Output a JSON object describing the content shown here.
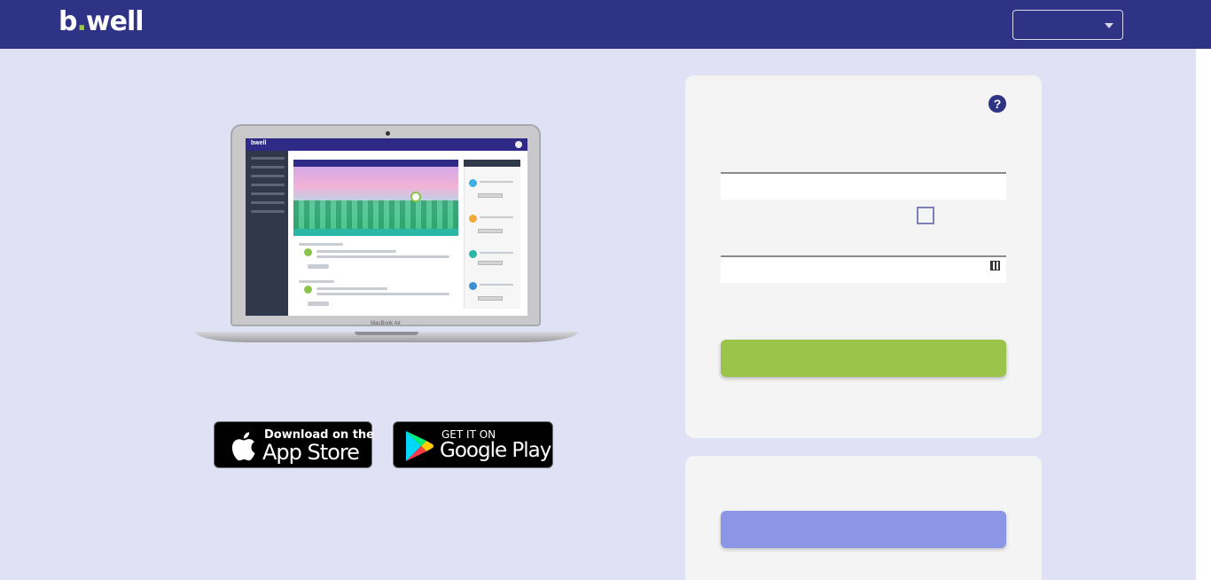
{
  "header": {
    "logo_text_b": "b",
    "logo_text_dot": ".",
    "logo_text_rest": "well",
    "language_select_value": "",
    "background_color": "#2e3386"
  },
  "hero": {
    "laptop_model_label": "MacBook Air",
    "app_preview_logo": "bwell"
  },
  "store_badges": {
    "app_store": {
      "small": "Download on the",
      "big": "App Store"
    },
    "google_play": {
      "small": "GET IT ON",
      "big": "Google Play"
    }
  },
  "login": {
    "help_icon_glyph": "?",
    "username_value": "",
    "username_placeholder": "",
    "password_value": "",
    "password_placeholder": "",
    "remember_checked": false,
    "login_button_label": "",
    "login_button_color": "#9bc54a"
  },
  "signup": {
    "signup_button_label": "",
    "signup_button_color": "#8b97e6"
  },
  "colors": {
    "page_background": "#e1e1f5",
    "panel_background": "#f4f4f4",
    "accent_green": "#9fc54a"
  }
}
